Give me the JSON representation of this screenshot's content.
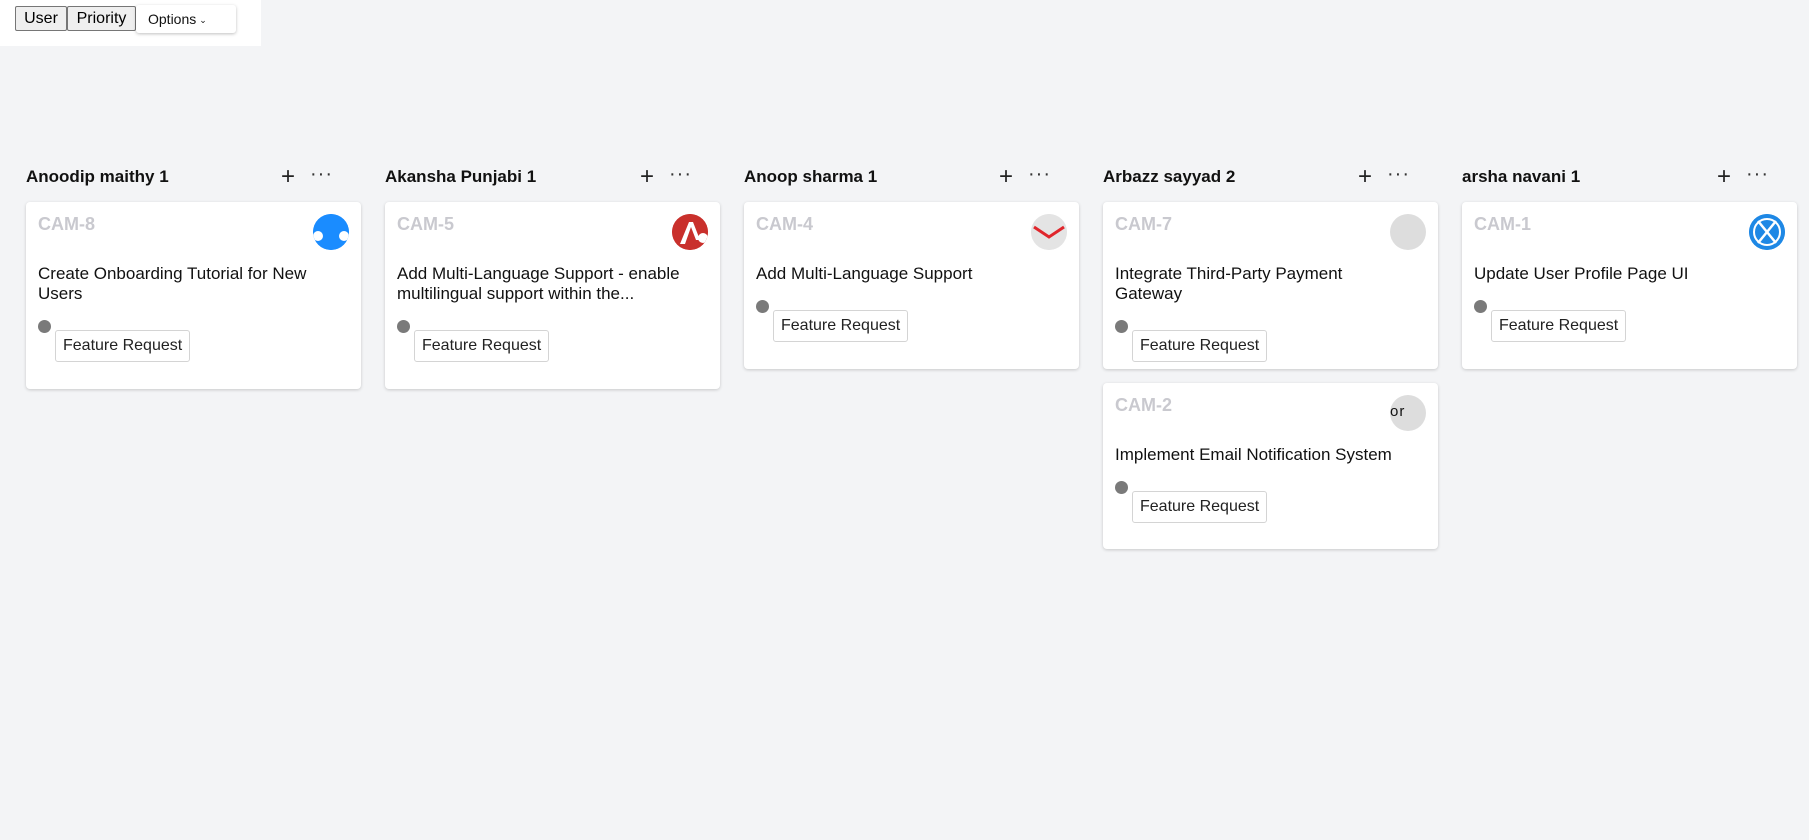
{
  "toolbar": {
    "user_label": "User",
    "priority_label": "Priority",
    "options_label": "Options"
  },
  "columns": [
    {
      "name": "Anoodip maithy",
      "count": "1",
      "cards": [
        {
          "id": "CAM-8",
          "title": "Create Onboarding Tutorial for New Users",
          "tag": "Feature Request",
          "avatar": "blue-cloud-avatar"
        }
      ]
    },
    {
      "name": "Akansha Punjabi",
      "count": "1",
      "cards": [
        {
          "id": "CAM-5",
          "title": "Add Multi-Language Support - enable multilingual support within the...",
          "tag": "Feature Request",
          "avatar": "red-logo-avatar"
        }
      ]
    },
    {
      "name": "Anoop sharma",
      "count": "1",
      "cards": [
        {
          "id": "CAM-4",
          "title": "Add Multi-Language Support",
          "tag": "Feature Request",
          "avatar": "mail-logo-avatar"
        }
      ]
    },
    {
      "name": "Arbazz sayyad",
      "count": "2",
      "cards": [
        {
          "id": "CAM-7",
          "title": "Integrate Third-Party Payment Gateway",
          "tag": "Feature Request",
          "avatar": "grey-avatar"
        },
        {
          "id": "CAM-2",
          "title": "Implement Email Notification System",
          "tag": "Feature Request",
          "avatar": "grey-text-avatar",
          "avatar_text": "or"
        }
      ]
    },
    {
      "name": "arsha navani",
      "count": "1",
      "cards": [
        {
          "id": "CAM-1",
          "title": "Update User Profile Page UI",
          "tag": "Feature Request",
          "avatar": "x-logo-avatar"
        }
      ]
    }
  ]
}
